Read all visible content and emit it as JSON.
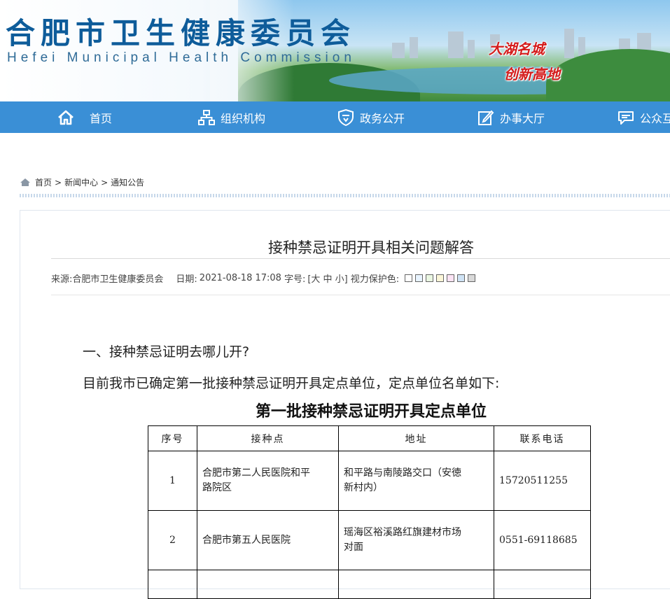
{
  "header": {
    "title": "合肥市卫生健康委员会",
    "subtitle": "Hefei Municipal Health Commission",
    "slogan_line1": "大湖名城",
    "slogan_line2": "创新高地"
  },
  "nav": {
    "items": [
      {
        "label": "首页",
        "icon": "home-icon"
      },
      {
        "label": "组织机构",
        "icon": "org-chart-icon"
      },
      {
        "label": "政务公开",
        "icon": "shield-icon"
      },
      {
        "label": "办事大厅",
        "icon": "edit-icon"
      },
      {
        "label": "公众互",
        "icon": "chat-icon"
      }
    ]
  },
  "breadcrumb": {
    "items": [
      "首页",
      "新闻中心",
      "通知公告"
    ],
    "separator": ">"
  },
  "article": {
    "title": "接种禁忌证明开具相关问题解答",
    "source_label": "来源:",
    "source_value": "合肥市卫生健康委员会",
    "date_label": "日期:",
    "date_value": "2021-08-18 17:08",
    "font_label": "字号:",
    "font_sizes": "[大 中 小]",
    "eye_care_label": "视力保护色:",
    "eye_care_colors": [
      "#ffffff",
      "#e8f4ff",
      "#eaf7e2",
      "#fbf6d8",
      "#fbe3f4",
      "#cfe3f5",
      "#d9d9d9"
    ],
    "question1": "一、接种禁忌证明去哪儿开?",
    "paragraph1": "目前我市已确定第一批接种禁忌证明开具定点单位，定点单位名单如下:",
    "table_title": "第一批接种禁忌证明开具定点单位",
    "table": {
      "headers": [
        "序号",
        "接种点",
        "地址",
        "联系电话"
      ],
      "rows": [
        {
          "no": "1",
          "site_line1": "合肥市第二人民医院和平",
          "site_line2": "路院区",
          "addr_line1": "和平路与南陵路交口（安徳",
          "addr_line2": "新村内）",
          "phone": "15720511255"
        },
        {
          "no": "2",
          "site_line1": "合肥市第五人民医院",
          "site_line2": "",
          "addr_line1": "瑶海区裕溪路红旗建材市场",
          "addr_line2": "对面",
          "phone": "0551-69118685"
        }
      ]
    }
  }
}
